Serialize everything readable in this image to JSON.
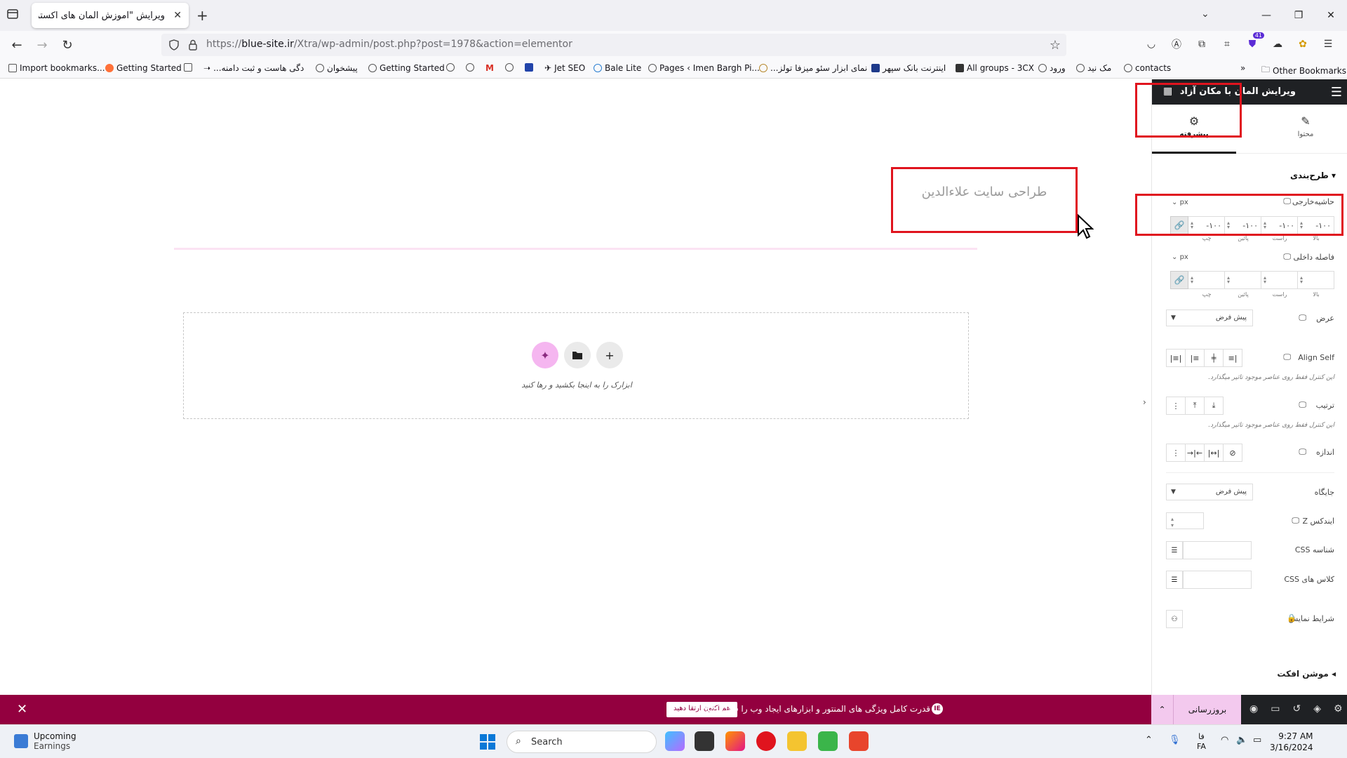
{
  "browser": {
    "tab_title": "ویرایش \"آموزش المان های اکسترا – ...",
    "url_prefix": "https://",
    "url_host": "blue-site.ir",
    "url_path": "/Xtra/wp-admin/post.php?post=1978&action=elementor",
    "extension_badge": "41"
  },
  "bookmarks": [
    "Import bookmarks...",
    "Getting Started",
    "دگی هاست و ثبت دامنه...",
    "پیشخوان",
    "Getting Started",
    "Jet SEO",
    "Bale Lite",
    "Pages ‹ Imen Bargh Pi...",
    "نمای ابزار سئو میزفا تولز...",
    "اینترنت بانک سپهر",
    "All groups - 3CX",
    "ورود",
    "مک نید",
    "contacts"
  ],
  "bookmarks_other": "Other Bookmarks",
  "canvas": {
    "heading_text": "طراحی سایت علاءالدین",
    "drop_text": "ابزارک را به اینجا بکشید و رها کنید"
  },
  "panel": {
    "header_title": "ویرایش المان با مکان آزاد",
    "tab_content": "محتوا",
    "tab_advanced": "پیشرفته",
    "section_layout": "طرح‌بندی",
    "margin_label": "حاشیه‌خارجی",
    "padding_label": "فاصله داخلی",
    "unit": "px",
    "margin_values": [
      "-۱۰۰",
      "-۱۰۰",
      "-۱۰۰",
      "-۱۰۰"
    ],
    "dim_labels": [
      "بالا",
      "راست",
      "پائین",
      "چپ"
    ],
    "width_label": "عرض",
    "width_value": "پیش فرض",
    "align_self_label": "Align Self",
    "help_text": "این کنترل فقط روی عناصر موجود تاثیر میگذارد.",
    "order_label": "ترتیب",
    "size_label": "اندازه",
    "position_label": "جایگاه",
    "position_value": "پیش فرض",
    "zindex_label": "ایندکس Z",
    "css_id_label": "شناسه CSS",
    "css_class_label": "کلاس های CSS",
    "display_conditions_label": "شرایط نمایش",
    "motion_effects_label": "موشن افکت"
  },
  "notice": {
    "text": "قدرت کامل ویژگی های المنتور و ابزارهای ایجاد وب را فعال کنید.",
    "button": "هم اکنون ارتقا دهید"
  },
  "panel_footer": {
    "update_label": "بروزرسانی"
  },
  "taskbar": {
    "weather_title": "Upcoming",
    "weather_sub": "Earnings",
    "search_text": "Search",
    "lang_1": "فا",
    "lang_2": "FA",
    "time": "9:27 AM",
    "date": "3/16/2024"
  }
}
